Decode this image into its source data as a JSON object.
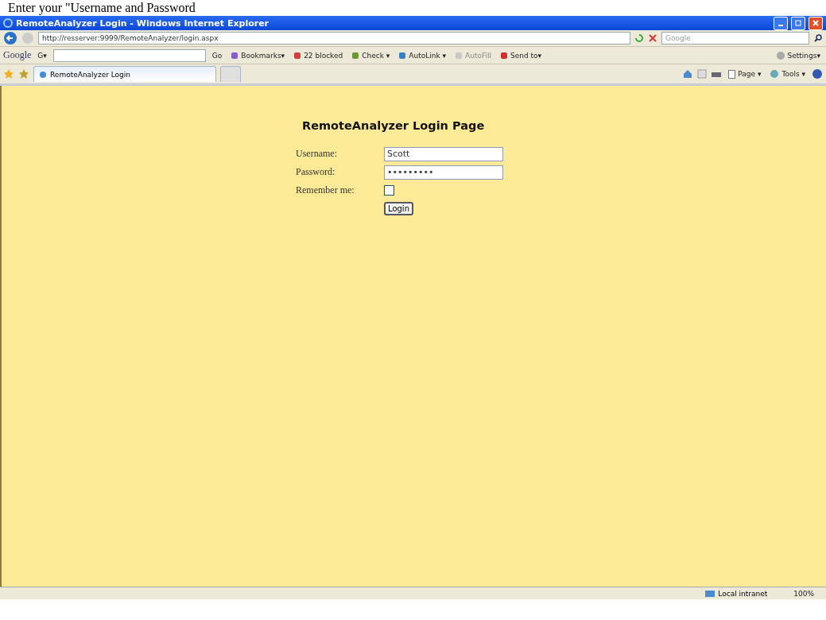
{
  "caption": "Enter your \"Username and Password",
  "window": {
    "title": "RemoteAnalyzer Login - Windows Internet Explorer"
  },
  "address_bar": {
    "url": "http://resserver:9999/RemoteAnalyzer/login.aspx",
    "search_placeholder": "Google"
  },
  "google_toolbar": {
    "logo": "Google",
    "search_menu": "G▾",
    "go": "Go",
    "buttons": [
      {
        "label": "Bookmarks▾",
        "disabled": false
      },
      {
        "label": "22 blocked",
        "disabled": false
      },
      {
        "label": "Check ▾",
        "disabled": false
      },
      {
        "label": "AutoLink ▾",
        "disabled": false
      },
      {
        "label": "AutoFill",
        "disabled": true
      },
      {
        "label": "Send to▾",
        "disabled": false
      }
    ],
    "settings": "Settings▾"
  },
  "tabs": [
    {
      "label": "RemoteAnalyzer Login",
      "selected": true
    }
  ],
  "command_bar": [
    {
      "label": "Page ▾"
    },
    {
      "label": "Tools ▾"
    }
  ],
  "page": {
    "heading": "RemoteAnalyzer Login Page",
    "fields": [
      {
        "label": "Username:",
        "kind": "text",
        "value": "Scott"
      },
      {
        "label": "Password:",
        "kind": "password",
        "value": "•••••••••"
      },
      {
        "label": "Remember me:",
        "kind": "checkbox",
        "checked": false
      }
    ],
    "submit": "Login"
  },
  "status_bar": {
    "zone": "Local intranet",
    "zoom": "100%"
  }
}
